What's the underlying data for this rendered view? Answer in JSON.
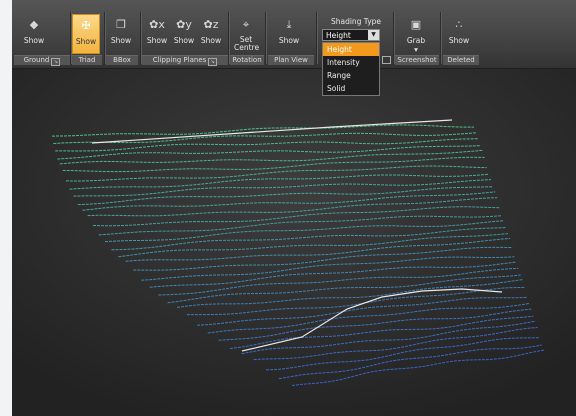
{
  "ribbon": {
    "buttons": [
      {
        "label": "Show",
        "icon": "diamond-icon"
      },
      {
        "label": "Show",
        "icon": "axes-icon",
        "active": true
      },
      {
        "label": "Show",
        "icon": "box-icon"
      },
      {
        "label": "Show",
        "icon": "clip-x-icon"
      },
      {
        "label": "Show",
        "icon": "clip-y-icon"
      },
      {
        "label": "Show",
        "icon": "clip-z-icon"
      },
      {
        "label": "Set Centre",
        "icon": "crosshair-icon"
      },
      {
        "label": "Show",
        "icon": "arrow-down-icon"
      },
      {
        "label": "Grab",
        "icon": "camera-icon"
      },
      {
        "label": "Show",
        "icon": "dots-icon"
      }
    ],
    "groups": {
      "ground": "Ground",
      "triad": "Triad",
      "bbox": "BBox",
      "clipping": "Clipping Planes",
      "rotation": "Rotation",
      "plan_view": "Plan View",
      "screenshot": "Screenshot",
      "deleted": "Deleted"
    },
    "shading": {
      "label": "Shading Type",
      "selected": "Height",
      "options": [
        "Height",
        "Intensity",
        "Range",
        "Solid"
      ]
    }
  },
  "colors": {
    "accent": "#f39a1e",
    "top_line": "#4ec08a",
    "bottom_line": "#3a63c8"
  }
}
